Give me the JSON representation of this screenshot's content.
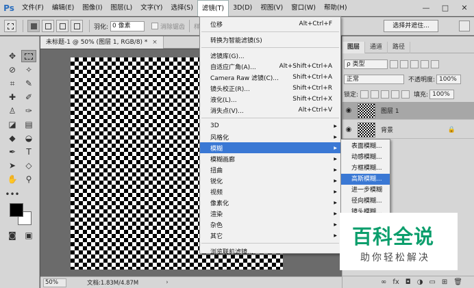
{
  "app": {
    "logo": "Ps"
  },
  "menubar": {
    "items": [
      "文件(F)",
      "编辑(E)",
      "图像(I)",
      "图层(L)",
      "文字(Y)",
      "选择(S)",
      "滤镜(T)",
      "3D(D)",
      "视图(V)",
      "窗口(W)",
      "帮助(H)"
    ],
    "active_index": 6
  },
  "window_controls": {
    "minimize": "—",
    "maximize": "□",
    "close": "✕"
  },
  "options": {
    "feather_label": "羽化:",
    "feather_value": "0 像素",
    "antialias_label": "消除锯齿",
    "style_label": "样式:",
    "select_and_mask": "选择并遮住..."
  },
  "document": {
    "tab_title": "未标题-1 @ 50% (图层 1, RGB/8) *",
    "close": "×",
    "zoom": "50%",
    "info": "文档:1.83M/4.87M",
    "status_arrow": "›"
  },
  "panel": {
    "tabs": [
      "图层",
      "通道",
      "路径"
    ],
    "active_tab": 0,
    "kind_label": "ρ 类型",
    "blend_mode": "正常",
    "opacity_label": "不透明度:",
    "opacity_value": "100%",
    "lock_label": "锁定:",
    "fill_label": "填充:",
    "fill_value": "100%",
    "layers": [
      {
        "name": "图层 1",
        "selected": true
      },
      {
        "name": "背景",
        "selected": false,
        "locked": true
      }
    ],
    "bottom_icons": [
      "∞",
      "fx",
      "◘",
      "◑",
      "▭",
      "⊞",
      "🗑"
    ]
  },
  "filter_menu": {
    "items": [
      {
        "label": "位移",
        "shortcut": "Alt+Ctrl+F"
      },
      {
        "sep": true
      },
      {
        "label": "转换为智能滤镜(S)",
        "shortcut": ""
      },
      {
        "sep": true
      },
      {
        "label": "滤镜库(G)...",
        "shortcut": ""
      },
      {
        "label": "自适应广角(A)...",
        "shortcut": "Alt+Shift+Ctrl+A"
      },
      {
        "label": "Camera Raw 滤镜(C)...",
        "shortcut": "Shift+Ctrl+A"
      },
      {
        "label": "镜头校正(R)...",
        "shortcut": "Shift+Ctrl+R"
      },
      {
        "label": "液化(L)...",
        "shortcut": "Shift+Ctrl+X"
      },
      {
        "label": "消失点(V)...",
        "shortcut": "Alt+Ctrl+V"
      },
      {
        "sep": true
      },
      {
        "label": "3D",
        "submenu": true
      },
      {
        "label": "风格化",
        "submenu": true
      },
      {
        "label": "模糊",
        "submenu": true,
        "highlight": true
      },
      {
        "label": "模糊画廊",
        "submenu": true
      },
      {
        "label": "扭曲",
        "submenu": true
      },
      {
        "label": "锐化",
        "submenu": true
      },
      {
        "label": "视频",
        "submenu": true
      },
      {
        "label": "像素化",
        "submenu": true
      },
      {
        "label": "渲染",
        "submenu": true
      },
      {
        "label": "杂色",
        "submenu": true
      },
      {
        "label": "其它",
        "submenu": true
      },
      {
        "sep": true
      },
      {
        "label": "浏览联机滤镜..."
      }
    ]
  },
  "blur_menu": {
    "items": [
      {
        "label": "表面模糊..."
      },
      {
        "label": "动感模糊..."
      },
      {
        "label": "方框模糊..."
      },
      {
        "label": "高斯模糊...",
        "highlight": true
      },
      {
        "label": "进一步模糊"
      },
      {
        "label": "径向模糊..."
      },
      {
        "label": "镜头模糊..."
      }
    ]
  },
  "watermark": {
    "title": "百科全说",
    "subtitle": "助你轻松解决"
  },
  "colors": {
    "highlight": "#3a78d4",
    "watermark_green": "#0c9e6c",
    "foreground": "#000000",
    "background": "#ffffff"
  }
}
